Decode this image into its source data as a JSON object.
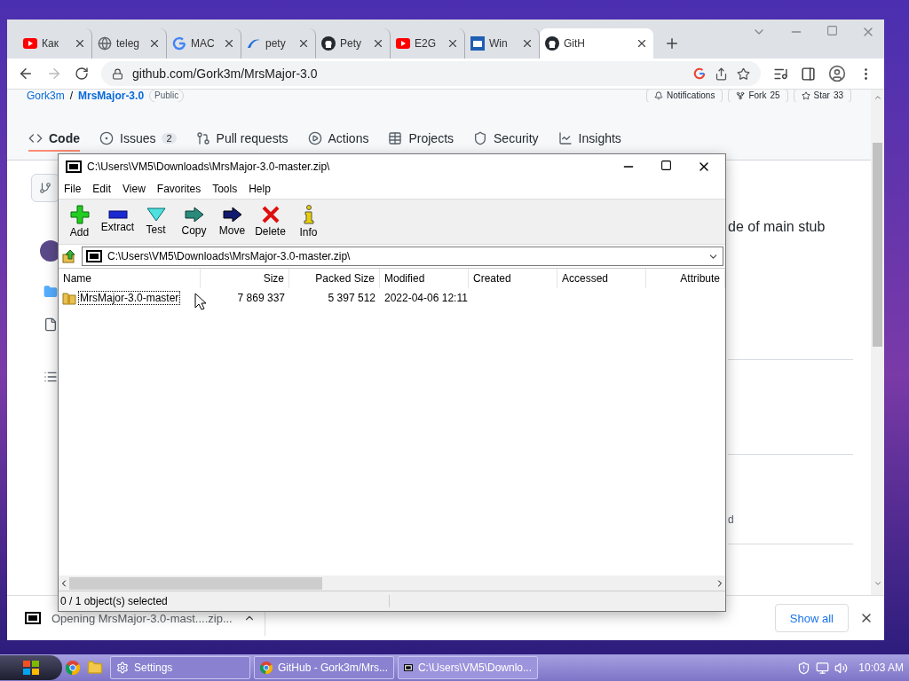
{
  "browser": {
    "tabs": [
      {
        "title": "Как",
        "kind": "youtube",
        "selected": false
      },
      {
        "title": "teleg",
        "kind": "globe",
        "selected": false
      },
      {
        "title": "MAC",
        "kind": "google",
        "selected": false
      },
      {
        "title": "pety",
        "kind": "swoosh",
        "selected": false
      },
      {
        "title": "Pety",
        "kind": "github",
        "selected": false
      },
      {
        "title": "E2G",
        "kind": "youtube",
        "selected": false
      },
      {
        "title": "Win",
        "kind": "site",
        "selected": false
      },
      {
        "title": "GitH",
        "kind": "github",
        "selected": true
      }
    ],
    "url": "github.com/Gork3m/MrsMajor-3.0"
  },
  "repo": {
    "owner": "Gork3m",
    "separator": "/",
    "name": "MrsMajor-3.0",
    "visibility": "Public",
    "notifications": "Notifications",
    "fork": "Fork",
    "fork_count": "25",
    "star": "Star",
    "star_count": "33"
  },
  "repo_nav": [
    {
      "label": "Code",
      "kind": "code",
      "selected": true
    },
    {
      "label": "Issues",
      "kind": "issue",
      "count": "2",
      "selected": false
    },
    {
      "label": "Pull requests",
      "kind": "pull",
      "selected": false
    },
    {
      "label": "Actions",
      "kind": "play",
      "selected": false
    },
    {
      "label": "Projects",
      "kind": "table",
      "selected": false
    },
    {
      "label": "Security",
      "kind": "shield",
      "selected": false
    },
    {
      "label": "Insights",
      "kind": "graph",
      "selected": false
    }
  ],
  "page_fragments": {
    "description": "de of main stub",
    "snippet": "d"
  },
  "archive_window": {
    "title": "C:\\Users\\VM5\\Downloads\\MrsMajor-3.0-master.zip\\",
    "menu": [
      "File",
      "Edit",
      "View",
      "Favorites",
      "Tools",
      "Help"
    ],
    "toolbar": [
      {
        "label": "Add",
        "kind": "add"
      },
      {
        "label": "Extract",
        "kind": "extract"
      },
      {
        "label": "Test",
        "kind": "test"
      },
      {
        "label": "Copy",
        "kind": "copy"
      },
      {
        "label": "Move",
        "kind": "move"
      },
      {
        "label": "Delete",
        "kind": "delete"
      },
      {
        "label": "Info",
        "kind": "info"
      }
    ],
    "path": "C:\\Users\\VM5\\Downloads\\MrsMajor-3.0-master.zip\\",
    "columns": [
      "Name",
      "Size",
      "Packed Size",
      "Modified",
      "Created",
      "Accessed",
      "Attribute"
    ],
    "rows": [
      {
        "name": "MrsMajor-3.0-master",
        "size": "7 869 337",
        "packed_size": "5 397 512",
        "modified": "2022-04-06 12:11",
        "focused": true
      }
    ],
    "status": "0 / 1 object(s) selected"
  },
  "download": {
    "text": "Opening MrsMajor-3.0-mast....zip...",
    "show_all": "Show all"
  },
  "taskbar": {
    "buttons": [
      {
        "label": "Settings",
        "kind": "settings",
        "selected": false
      },
      {
        "label": "GitHub - Gork3m/Mrs...",
        "kind": "chrome",
        "selected": false
      },
      {
        "label": "C:\\Users\\VM5\\Downlo...",
        "kind": "sevenzip",
        "selected": true
      }
    ],
    "clock": "10:03 AM"
  }
}
